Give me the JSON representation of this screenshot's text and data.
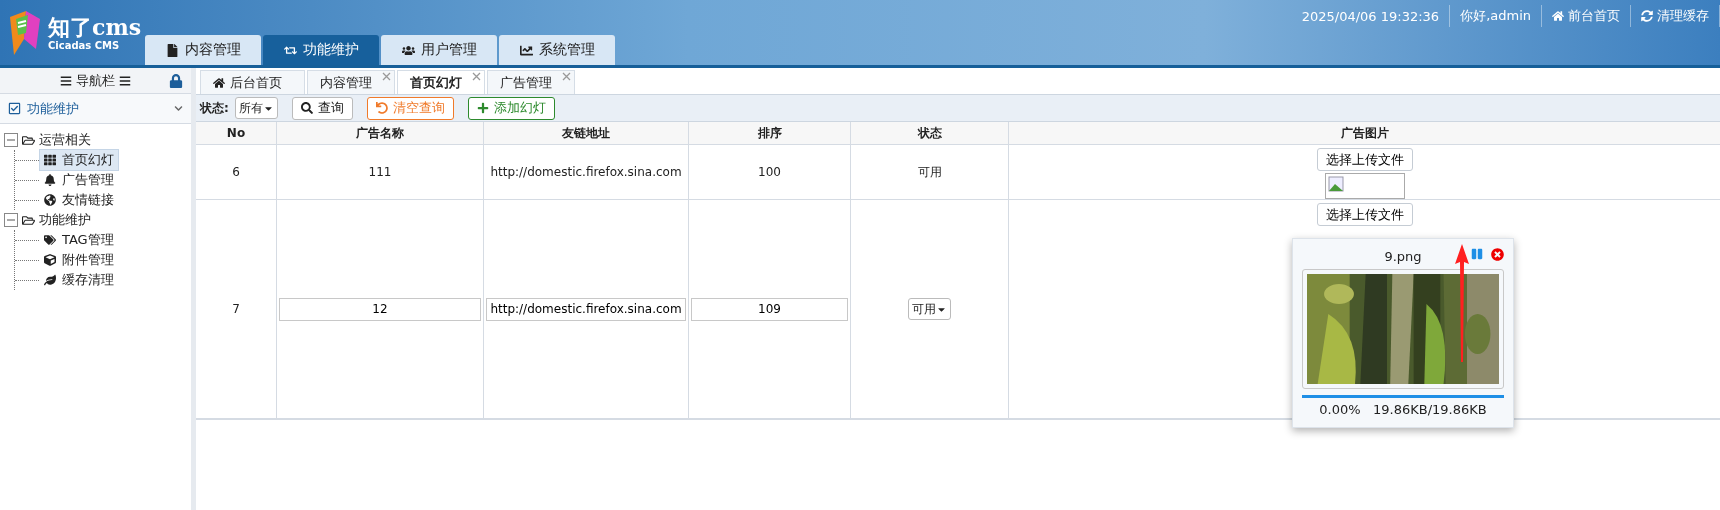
{
  "header": {
    "logo_title": "知了cms",
    "logo_subtitle": "Cicadas CMS",
    "main_tabs": [
      {
        "label": "内容管理",
        "selected": false
      },
      {
        "label": "功能维护",
        "selected": true
      },
      {
        "label": "用户管理",
        "selected": false
      },
      {
        "label": "系统管理",
        "selected": false
      }
    ],
    "datetime": "2025/04/06 19:32:36",
    "greeting": "你好,admin",
    "links": [
      "前台首页",
      "清理缓存"
    ]
  },
  "sidebar": {
    "title": "导航栏",
    "section": "功能维护",
    "tree": [
      {
        "label": "运营相关",
        "expanded": true,
        "children": [
          {
            "label": "首页幻灯",
            "selected": true
          },
          {
            "label": "广告管理",
            "selected": false
          },
          {
            "label": "友情链接",
            "selected": false
          }
        ]
      },
      {
        "label": "功能维护",
        "expanded": true,
        "children": [
          {
            "label": "TAG管理",
            "selected": false
          },
          {
            "label": "附件管理",
            "selected": false
          },
          {
            "label": "缓存清理",
            "selected": false
          }
        ]
      }
    ]
  },
  "content_tabs": [
    {
      "label": "后台首页",
      "selected": false,
      "closable": false
    },
    {
      "label": "内容管理",
      "selected": false,
      "closable": true
    },
    {
      "label": "首页幻灯",
      "selected": true,
      "closable": true
    },
    {
      "label": "广告管理",
      "selected": false,
      "closable": true
    }
  ],
  "toolbar": {
    "status_label": "状态:",
    "status_value": "所有",
    "buttons": [
      {
        "label": "查询",
        "kind": "search"
      },
      {
        "label": "清空查询",
        "kind": "clear"
      },
      {
        "label": "添加幻灯",
        "kind": "add"
      }
    ]
  },
  "table": {
    "columns": [
      "No",
      "广告名称",
      "友链地址",
      "排序",
      "状态",
      "广告图片"
    ],
    "rows": [
      {
        "kind": "view",
        "no": "6",
        "name": "111",
        "url": "http://domestic.firefox.sina.com",
        "order": "100",
        "status": "可用",
        "upload_button": "选择上传文件"
      },
      {
        "kind": "edit",
        "no": "7",
        "name": "12",
        "url": "http://domestic.firefox.sina.com",
        "order": "109",
        "status": "可用",
        "upload_button": "选择上传文件",
        "upload": {
          "file_name": "9.png",
          "level": 1,
          "percent": "0.00%",
          "size": "19.86KB/19.86KB"
        }
      }
    ]
  }
}
